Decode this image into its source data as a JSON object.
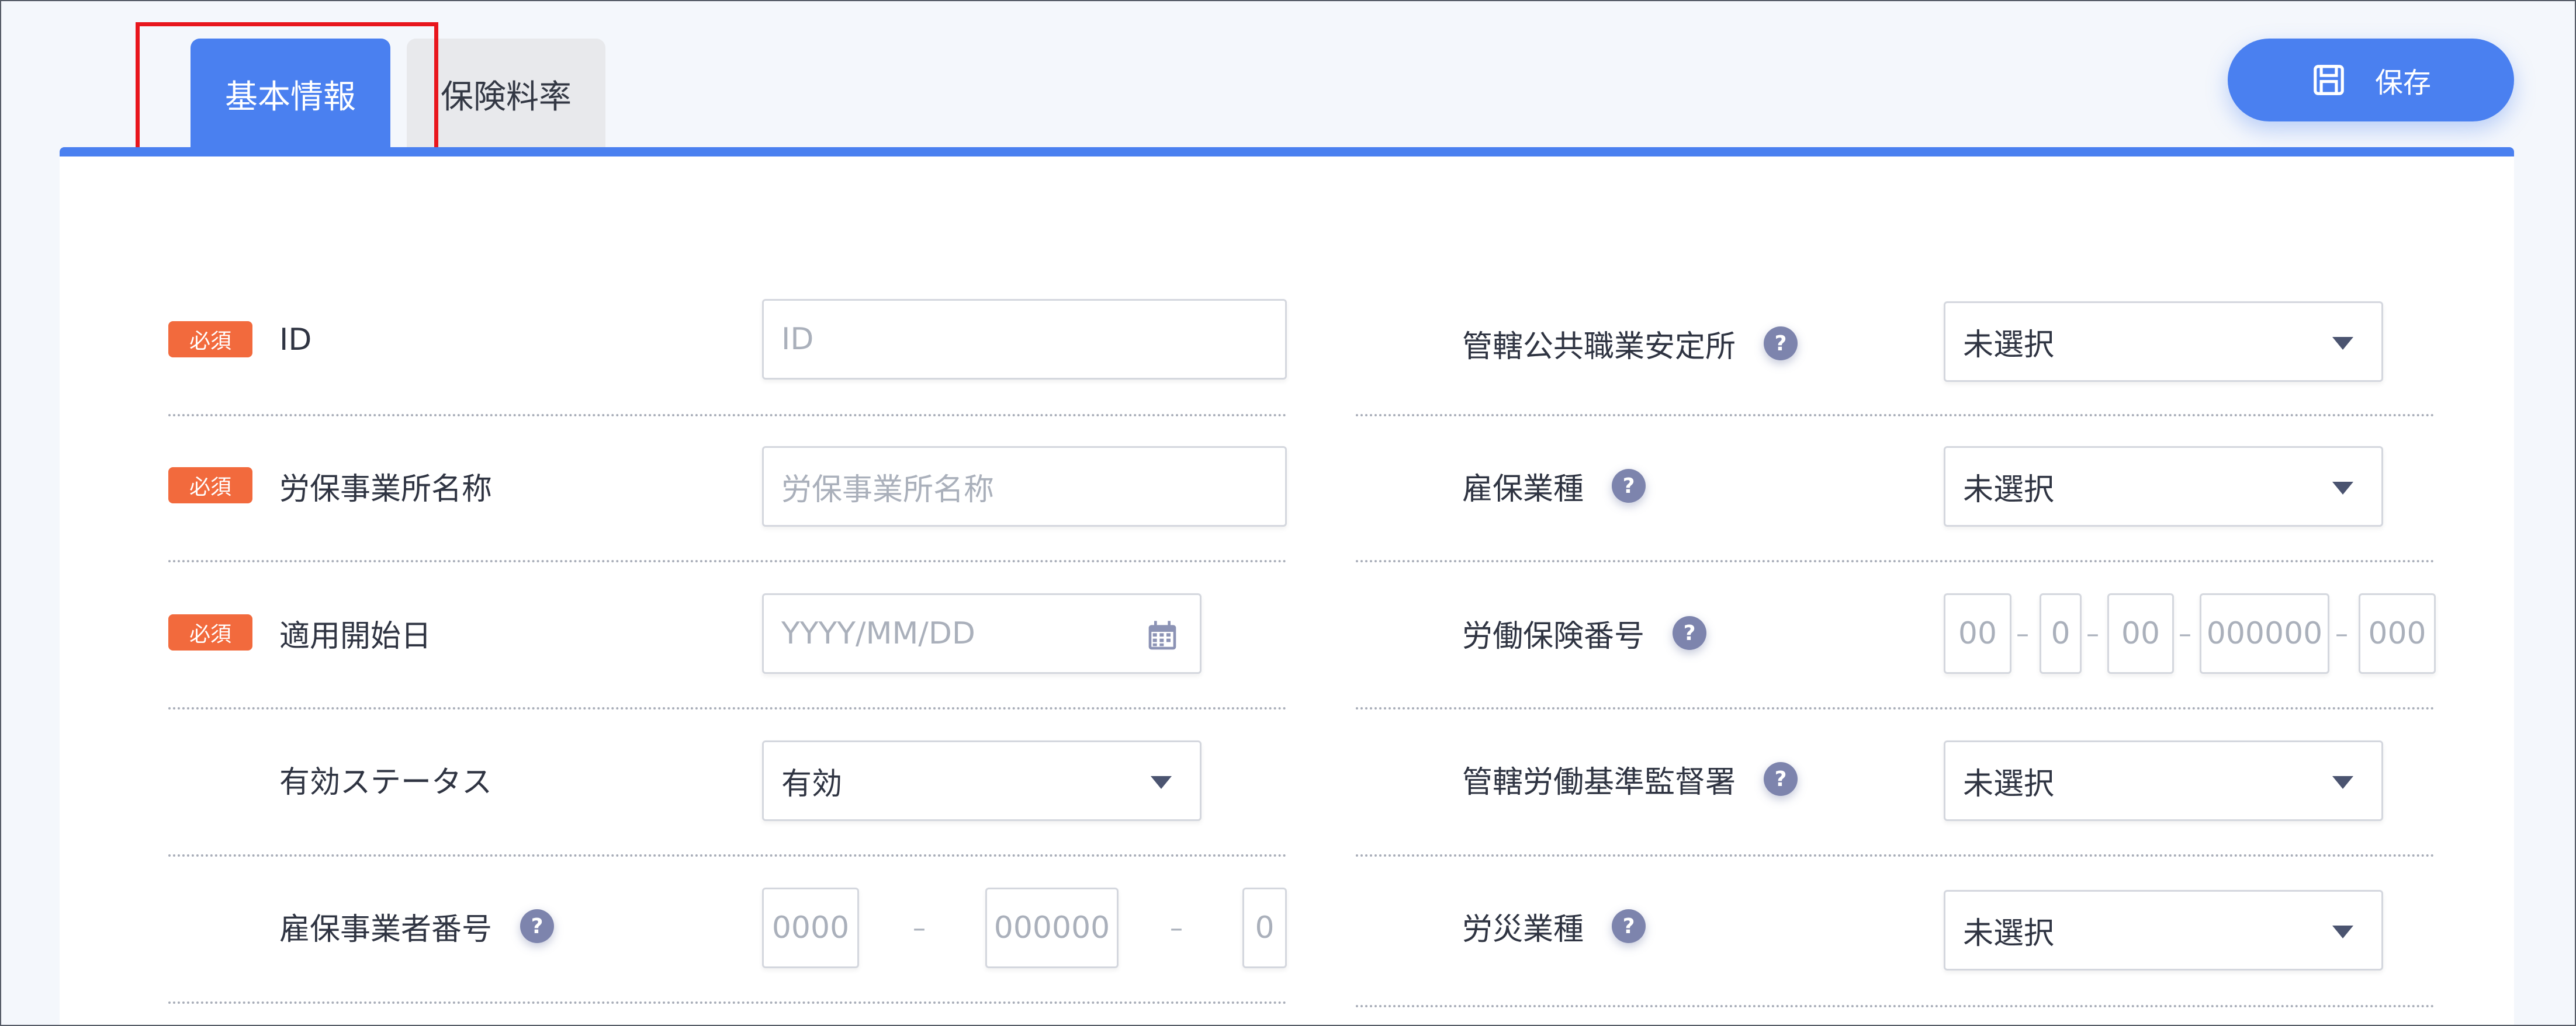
{
  "tabs": [
    {
      "label": "基本情報",
      "active": true
    },
    {
      "label": "保険料率",
      "active": false
    }
  ],
  "toolbar": {
    "save_label": "保存",
    "save_icon": "floppy-disk-icon"
  },
  "colors": {
    "accent": "#4a80f0",
    "required": "#f26a3d",
    "highlight": "#e8161d",
    "help": "#7d84ad"
  },
  "left_fields": [
    {
      "required_badge": "必須",
      "label": "ID",
      "placeholder": "ID"
    },
    {
      "required_badge": "必須",
      "label": "労保事業所名称",
      "placeholder": "労保事業所名称"
    },
    {
      "required_badge": "必須",
      "label": "適用開始日",
      "placeholder": "YYYY/MM/DD",
      "icon": "calendar-icon"
    },
    {
      "label": "有効ステータス",
      "value": "有効"
    },
    {
      "label": "雇保事業者番号",
      "help": "?",
      "segments": [
        "0000",
        "000000",
        "0"
      ],
      "separator": "–"
    }
  ],
  "right_fields": [
    {
      "label": "管轄公共職業安定所",
      "help": "?",
      "value": "未選択"
    },
    {
      "label": "雇保業種",
      "help": "?",
      "value": "未選択"
    },
    {
      "label": "労働保険番号",
      "help": "?",
      "segments": [
        "00",
        "0",
        "00",
        "000000",
        "000"
      ],
      "separator": "–"
    },
    {
      "label": "管轄労働基準監督署",
      "help": "?",
      "value": "未選択"
    },
    {
      "label": "労災業種",
      "help": "?",
      "value": "未選択"
    }
  ]
}
